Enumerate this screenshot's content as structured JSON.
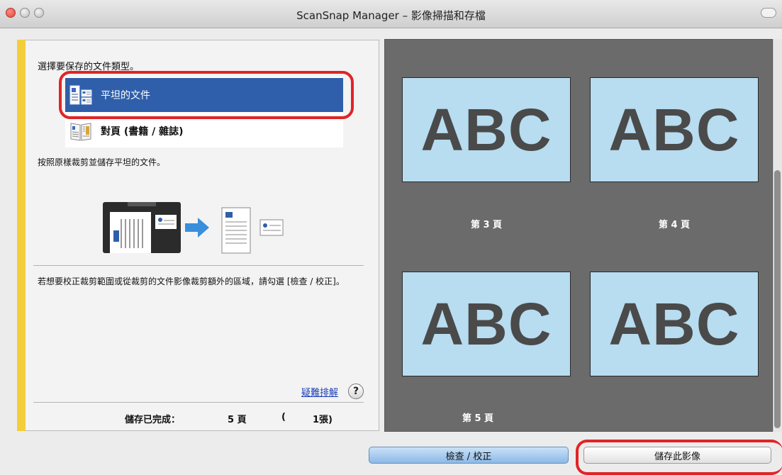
{
  "window": {
    "title": "ScanSnap Manager – 影像掃描和存檔"
  },
  "left_panel": {
    "heading": "選擇要保存的文件類型。",
    "options": [
      {
        "label": "平坦的文件",
        "icon": "flat-document-icon",
        "selected": true
      },
      {
        "label": "對頁 (書籍 / 雜誌)",
        "icon": "book-spread-icon",
        "selected": false
      }
    ],
    "description": "按照原樣裁剪並儲存平坦的文件。",
    "info": "若想要校正裁剪範圍或從裁剪的文件影像裁剪額外的區域，請勾選 [檢查 / 校正]。",
    "troubleshoot_link": "疑難排解",
    "help_symbol": "?",
    "status": {
      "label": "儲存已完成：",
      "pages": "5 頁",
      "paren_open": "(",
      "sheets": "1張)"
    }
  },
  "preview": {
    "thumbnails": [
      "ABC",
      "ABC",
      "ABC",
      "ABC"
    ],
    "page_labels": [
      "第 3 頁",
      "第 4 頁",
      "第 5 頁"
    ]
  },
  "buttons": {
    "check_correct": "檢查 / 校正",
    "save_image": "儲存此影像"
  },
  "colors": {
    "accent_stripe": "#f4cd3c",
    "selection": "#2f5faa",
    "highlight": "#e02427",
    "thumbnail_bg": "#b8dcf0",
    "preview_bg": "#6b6b6b"
  }
}
